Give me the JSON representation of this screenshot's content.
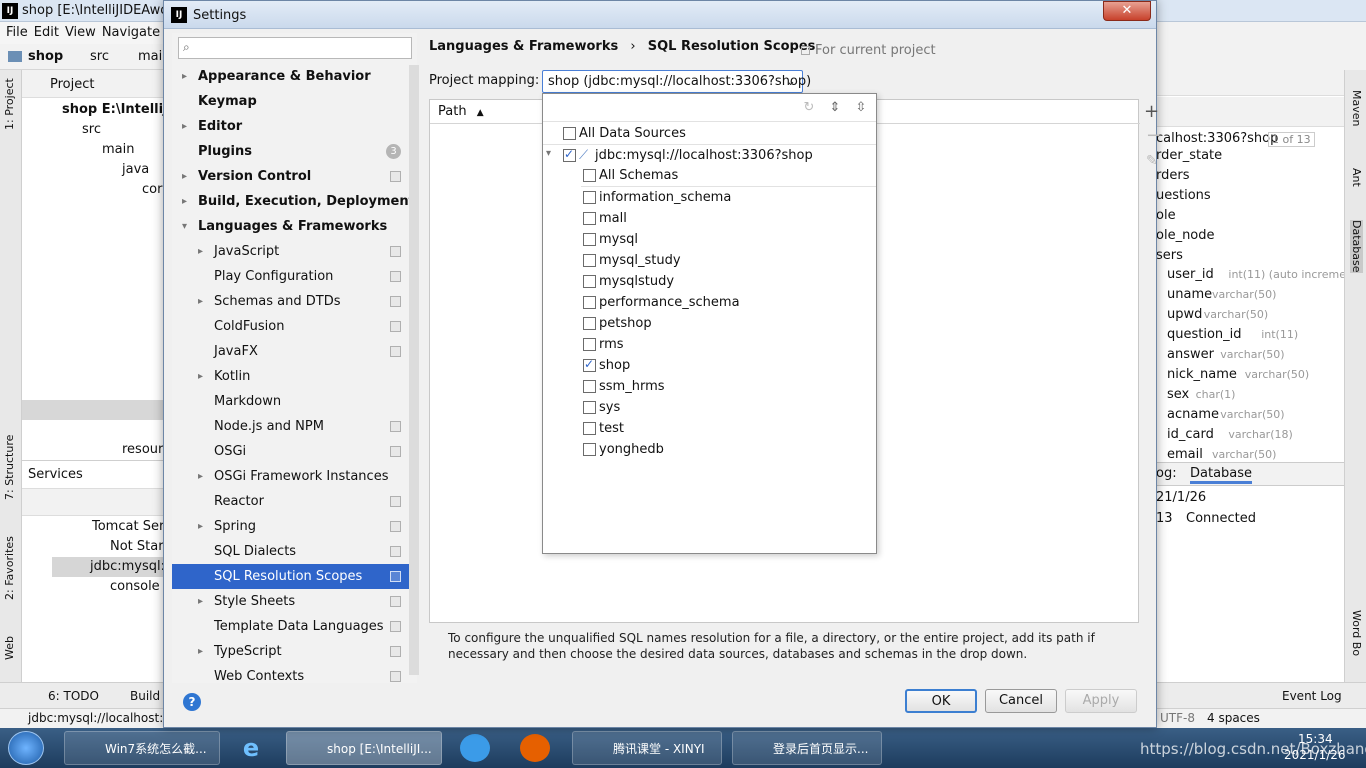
{
  "ide": {
    "window_title": "shop [E:\\IntelliJIDEAwork",
    "menu": [
      "File",
      "Edit",
      "View",
      "Navigate"
    ],
    "nav_crumbs": [
      "shop",
      "src",
      "mair"
    ],
    "project_label": "Project",
    "tree": [
      "shop  E:\\IntelliJIDI",
      "src",
      "main",
      "java",
      "cor",
      "resour"
    ],
    "services_title": "Services",
    "services_items": [
      "Tomcat Serv",
      "Not Start",
      "jdbc:mysql://",
      "console"
    ],
    "left_stripe": [
      "1: Project",
      "7: Structure",
      "2: Favorites",
      "Web"
    ],
    "right_panel": {
      "conn": "calhost:3306?shop",
      "page": "1 of 13",
      "tables": [
        "rder_state",
        "rders",
        "uestions",
        "ole",
        "ole_node",
        "sers"
      ],
      "columns": [
        {
          "name": "user_id",
          "type": "int(11) (auto incremer"
        },
        {
          "name": "uname",
          "type": "varchar(50)"
        },
        {
          "name": "upwd",
          "type": "varchar(50)"
        },
        {
          "name": "question_id",
          "type": "int(11)"
        },
        {
          "name": "answer",
          "type": "varchar(50)"
        },
        {
          "name": "nick_name",
          "type": "varchar(50)"
        },
        {
          "name": "sex",
          "type": "char(1)"
        },
        {
          "name": "acname",
          "type": "varchar(50)"
        },
        {
          "name": "id_card",
          "type": "varchar(18)"
        },
        {
          "name": "email",
          "type": "varchar(50)"
        }
      ],
      "log_tab": "og:",
      "db_tab": "Database",
      "log_date": "21/1/26",
      "log_time": "13",
      "log_status": "Connected"
    },
    "right_stripe": [
      "Maven",
      "Ant",
      "Database",
      "Word Bo"
    ],
    "bottom_tabs": [
      "6: TODO",
      "Build",
      "Event Log"
    ],
    "status_left": "jdbc:mysql://localhost:3",
    "status_encoding": "UTF-8",
    "status_indent": "4 spaces"
  },
  "dialog": {
    "title": "Settings",
    "close_label": "✕",
    "search_placeholder": "",
    "sidebar": [
      {
        "label": "Appearance & Behavior",
        "bold": true,
        "arrow": "▸",
        "indent": 0,
        "copy": false
      },
      {
        "label": "Keymap",
        "bold": true,
        "arrow": "",
        "indent": 0,
        "copy": false
      },
      {
        "label": "Editor",
        "bold": true,
        "arrow": "▸",
        "indent": 0,
        "copy": false
      },
      {
        "label": "Plugins",
        "bold": true,
        "arrow": "",
        "indent": 0,
        "copy": false,
        "badge": "3"
      },
      {
        "label": "Version Control",
        "bold": true,
        "arrow": "▸",
        "indent": 0,
        "copy": true
      },
      {
        "label": "Build, Execution, Deployment",
        "bold": true,
        "arrow": "▸",
        "indent": 0,
        "copy": false
      },
      {
        "label": "Languages & Frameworks",
        "bold": true,
        "arrow": "▾",
        "indent": 0,
        "copy": false
      },
      {
        "label": "JavaScript",
        "bold": false,
        "arrow": "▸",
        "indent": 1,
        "copy": true
      },
      {
        "label": "Play Configuration",
        "bold": false,
        "arrow": "",
        "indent": 1,
        "copy": true
      },
      {
        "label": "Schemas and DTDs",
        "bold": false,
        "arrow": "▸",
        "indent": 1,
        "copy": true
      },
      {
        "label": "ColdFusion",
        "bold": false,
        "arrow": "",
        "indent": 1,
        "copy": true
      },
      {
        "label": "JavaFX",
        "bold": false,
        "arrow": "",
        "indent": 1,
        "copy": true
      },
      {
        "label": "Kotlin",
        "bold": false,
        "arrow": "▸",
        "indent": 1,
        "copy": false
      },
      {
        "label": "Markdown",
        "bold": false,
        "arrow": "",
        "indent": 1,
        "copy": false
      },
      {
        "label": "Node.js and NPM",
        "bold": false,
        "arrow": "",
        "indent": 1,
        "copy": true
      },
      {
        "label": "OSGi",
        "bold": false,
        "arrow": "",
        "indent": 1,
        "copy": true
      },
      {
        "label": "OSGi Framework Instances",
        "bold": false,
        "arrow": "▸",
        "indent": 1,
        "copy": false
      },
      {
        "label": "Reactor",
        "bold": false,
        "arrow": "",
        "indent": 1,
        "copy": true
      },
      {
        "label": "Spring",
        "bold": false,
        "arrow": "▸",
        "indent": 1,
        "copy": true
      },
      {
        "label": "SQL Dialects",
        "bold": false,
        "arrow": "",
        "indent": 1,
        "copy": true
      },
      {
        "label": "SQL Resolution Scopes",
        "bold": false,
        "arrow": "",
        "indent": 1,
        "copy": true,
        "selected": true
      },
      {
        "label": "Style Sheets",
        "bold": false,
        "arrow": "▸",
        "indent": 1,
        "copy": true
      },
      {
        "label": "Template Data Languages",
        "bold": false,
        "arrow": "",
        "indent": 1,
        "copy": true
      },
      {
        "label": "TypeScript",
        "bold": false,
        "arrow": "▸",
        "indent": 1,
        "copy": true
      },
      {
        "label": "Web Contexts",
        "bold": false,
        "arrow": "",
        "indent": 1,
        "copy": true
      }
    ],
    "breadcrumb": {
      "first": "Languages & Frameworks",
      "sep": "›",
      "second": "SQL Resolution Scopes"
    },
    "for_current_project": "For current project",
    "project_mapping_label": "Project mapping:",
    "project_mapping_value": "shop (jdbc:mysql://localhost:3306?shop)",
    "path_header": "Path",
    "description": "To configure the unqualified SQL names resolution for a file, a directory, or the entire project, add its path if necessary and then choose the desired data sources, databases and schemas in the drop down.",
    "buttons": {
      "ok": "OK",
      "cancel": "Cancel",
      "apply": "Apply"
    },
    "help": "?"
  },
  "dropdown": {
    "all_data_sources": "All Data Sources",
    "datasource": "jdbc:mysql://localhost:3306?shop",
    "all_schemas": "All Schemas",
    "schemas": [
      {
        "name": "information_schema",
        "checked": false
      },
      {
        "name": "mall",
        "checked": false
      },
      {
        "name": "mysql",
        "checked": false
      },
      {
        "name": "mysql_study",
        "checked": false
      },
      {
        "name": "mysqlstudy",
        "checked": false
      },
      {
        "name": "performance_schema",
        "checked": false
      },
      {
        "name": "petshop",
        "checked": false
      },
      {
        "name": "rms",
        "checked": false
      },
      {
        "name": "shop",
        "checked": true
      },
      {
        "name": "ssm_hrms",
        "checked": false
      },
      {
        "name": "sys",
        "checked": false
      },
      {
        "name": "test",
        "checked": false
      },
      {
        "name": "yonghedb",
        "checked": false
      }
    ]
  },
  "taskbar": {
    "items": [
      "Win7系统怎么截...",
      "shop [E:\\IntelliJI...",
      "腾讯课堂 - XINYI",
      "登录后首页显示..."
    ],
    "time": "15:34",
    "date": "2021/1/26",
    "watermark": "https://blog.csdn.net/Boxzhang"
  }
}
